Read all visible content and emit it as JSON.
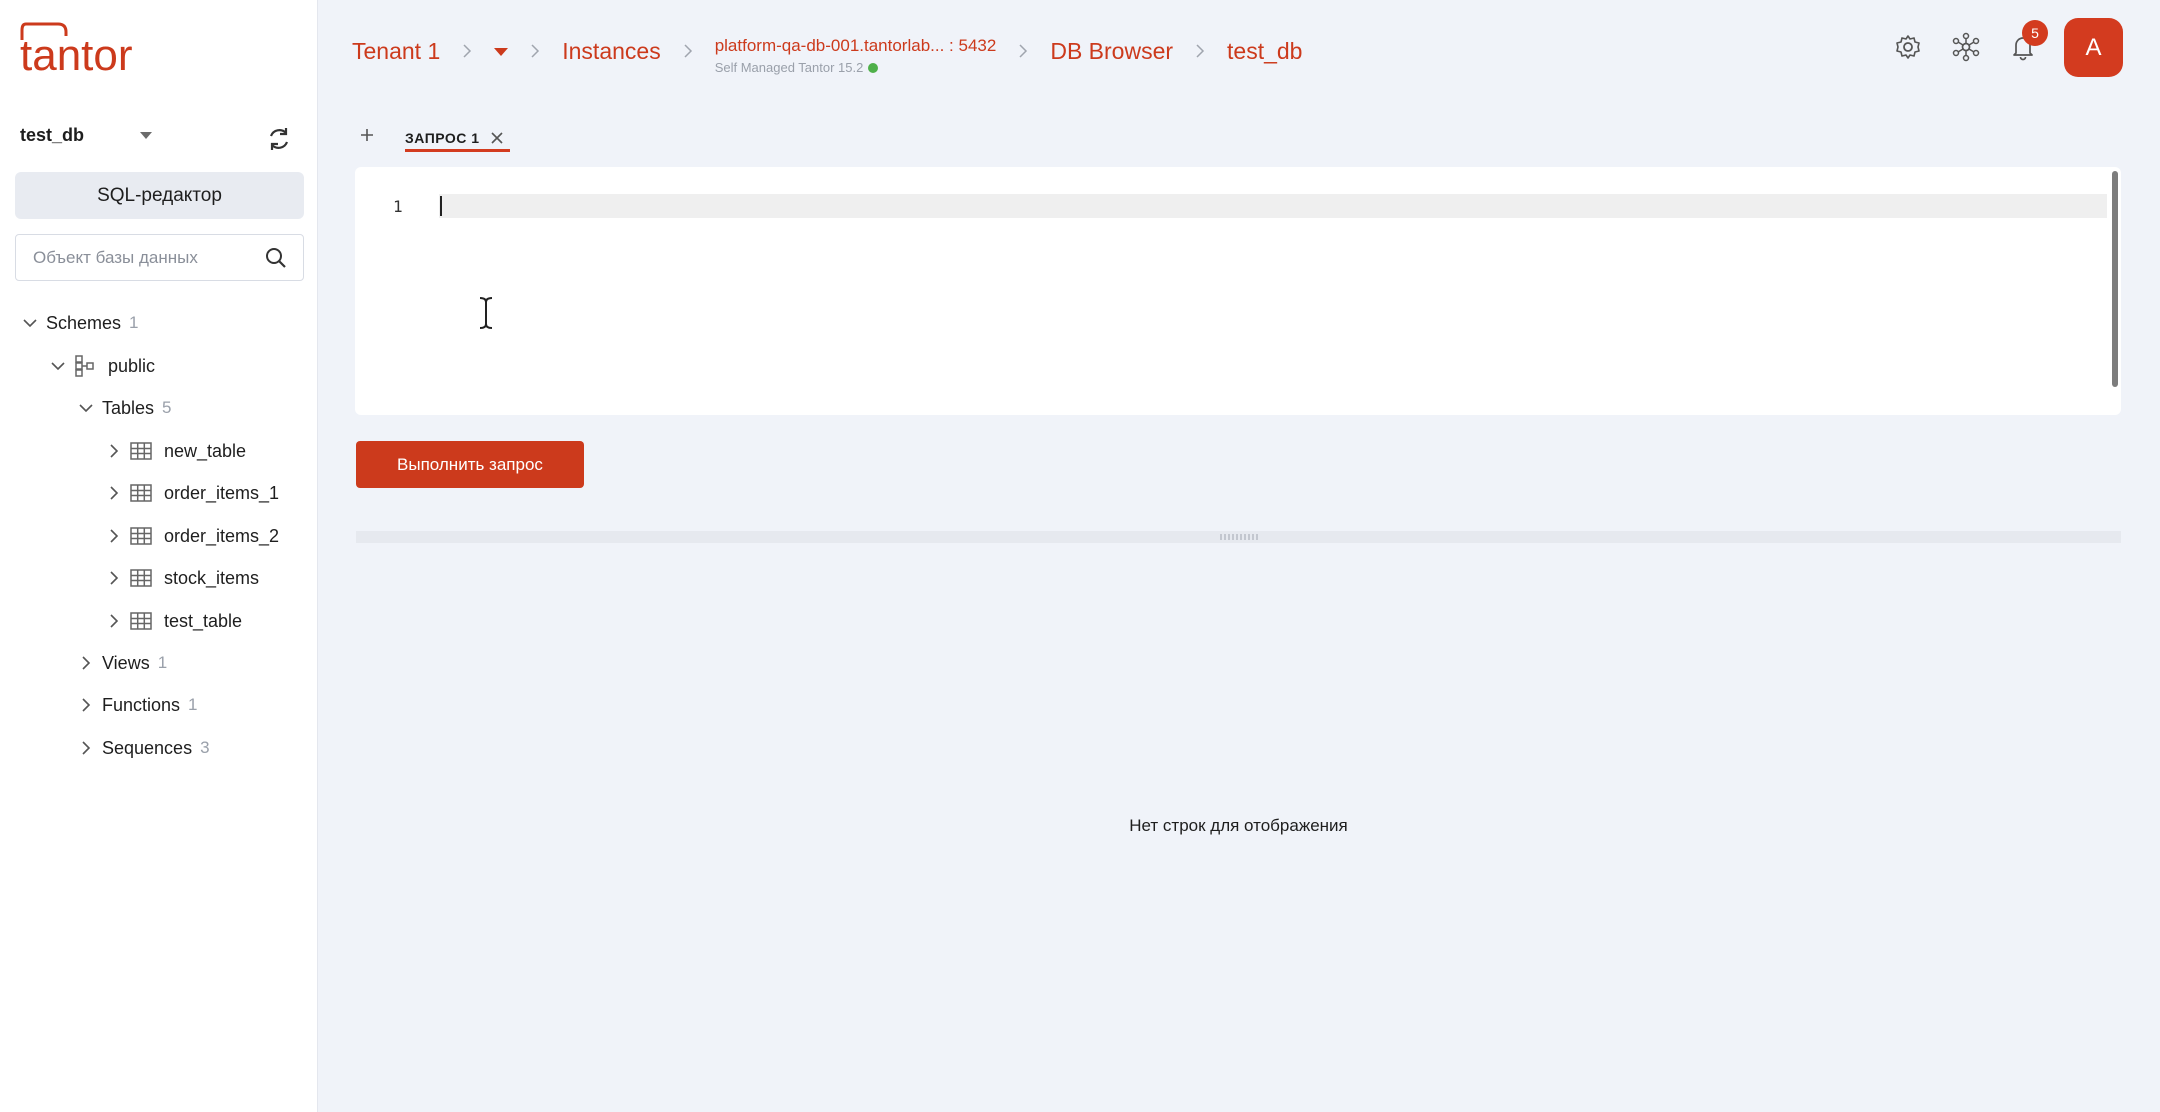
{
  "colors": {
    "brand": "#cc3a1c",
    "badge": "#d33b1f",
    "status_ok": "#4fb04a"
  },
  "sidebar": {
    "logo_text": "tantor",
    "database": "test_db",
    "sql_editor_label": "SQL-редактор",
    "search_placeholder": "Объект базы данных",
    "tree": {
      "schemes": {
        "label": "Schemes",
        "count": "1"
      },
      "public": {
        "label": "public"
      },
      "tables": {
        "label": "Tables",
        "count": "5",
        "items": [
          "new_table",
          "order_items_1",
          "order_items_2",
          "stock_items",
          "test_table"
        ]
      },
      "views": {
        "label": "Views",
        "count": "1"
      },
      "functions": {
        "label": "Functions",
        "count": "1"
      },
      "sequences": {
        "label": "Sequences",
        "count": "3"
      }
    }
  },
  "header": {
    "tenant": "Tenant 1",
    "instances": "Instances",
    "instance_host": "platform-qa-db-001.tantorlab... : 5432",
    "instance_sub": "Self Managed Tantor 15.2",
    "db_browser": "DB Browser",
    "database": "test_db",
    "notifications_count": "5",
    "avatar_initial": "A",
    "icons": [
      "gear-icon",
      "network-icon",
      "bell-icon"
    ]
  },
  "editor": {
    "tab_label": "ЗАПРОС 1",
    "line_number": "1",
    "run_label": "Выполнить запрос"
  },
  "results": {
    "empty_message": "Нет строк для отображения"
  }
}
